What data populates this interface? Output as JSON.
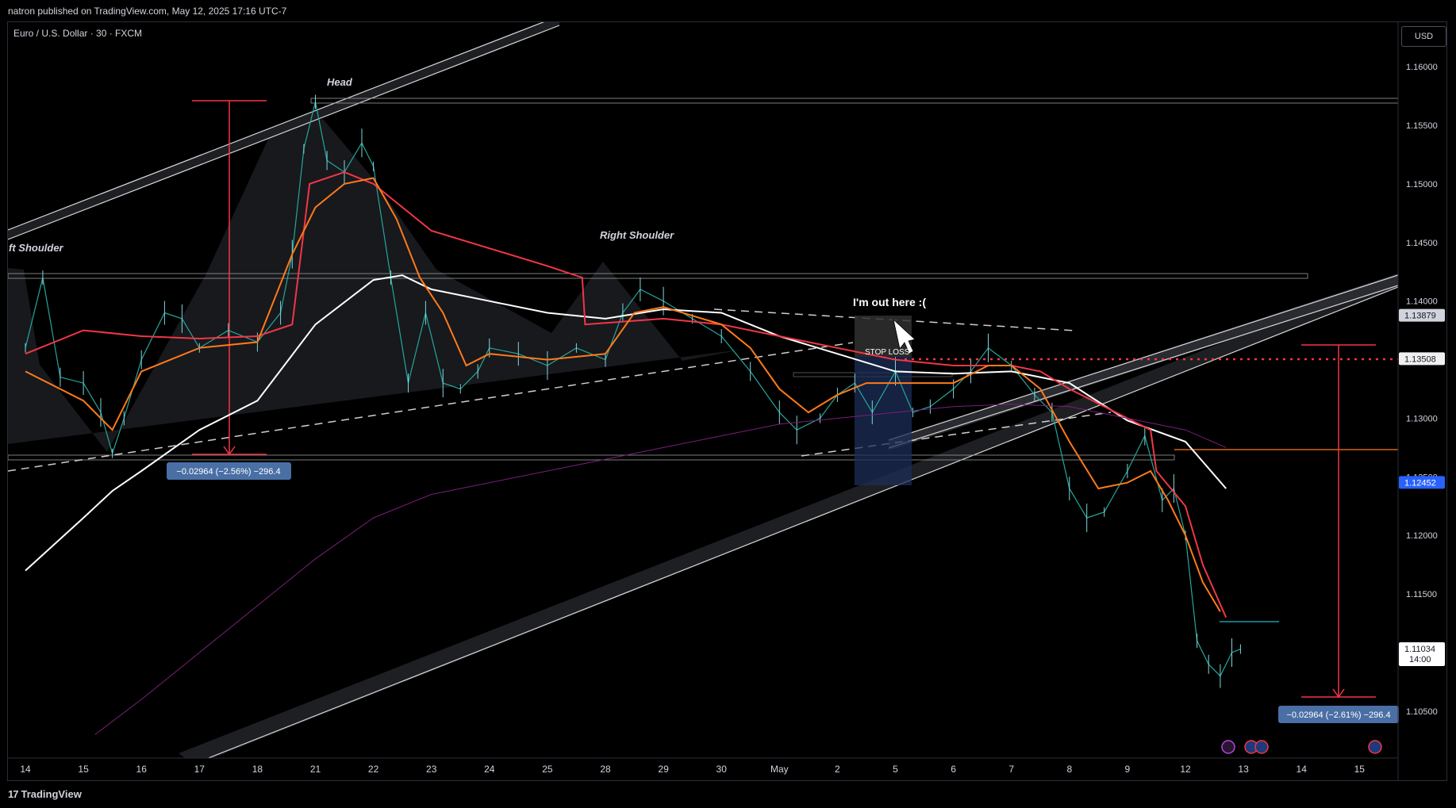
{
  "header": {
    "published_text": "natron published on TradingView.com, May 12, 2025 17:16 UTC-7"
  },
  "symbol": {
    "title": "Euro / U.S. Dollar · 30 · FXCM",
    "currency": "USD"
  },
  "footer": {
    "brand": "TradingView",
    "logo_glyph": "17"
  },
  "chart_data": {
    "type": "line",
    "title": "",
    "instrument": "Euro / U.S. Dollar",
    "interval": "30",
    "source": "FXCM",
    "y_ticks": [
      1.16,
      1.155,
      1.15,
      1.145,
      1.14,
      1.135,
      1.13,
      1.125,
      1.12,
      1.115,
      1.105
    ],
    "y_tick_labels": [
      "1.16000",
      "1.15500",
      "1.15000",
      "1.14500",
      "1.14000",
      "1.13500",
      "1.13000",
      "1.12500",
      "1.12000",
      "1.11500",
      "1.10500"
    ],
    "ylim": [
      1.101,
      1.1638
    ],
    "x_ticks": [
      "14",
      "15",
      "16",
      "17",
      "18",
      "21",
      "22",
      "23",
      "24",
      "25",
      "28",
      "29",
      "30",
      "May",
      "2",
      "5",
      "6",
      "7",
      "8",
      "9",
      "12",
      "13",
      "14",
      "15"
    ],
    "price_tags": [
      {
        "value": 1.13879,
        "label": "1.13879",
        "color": "#d1d4dc",
        "text_color": "#131722"
      },
      {
        "value": 1.13508,
        "label": "1.13508",
        "color": "#f0f0f0",
        "text_color": "#131722"
      },
      {
        "value": 1.12452,
        "label": "1.12452",
        "color": "#2962ff",
        "text_color": "#ffffff"
      },
      {
        "value": 1.11034,
        "label": "1.11034",
        "sublabel": "14:00",
        "color": "#ffffff",
        "text_color": "#131722"
      }
    ],
    "price_series": [
      [
        0,
        1.136
      ],
      [
        0.3,
        1.142
      ],
      [
        0.6,
        1.1335
      ],
      [
        1,
        1.133
      ],
      [
        1.3,
        1.1305
      ],
      [
        1.5,
        1.127
      ],
      [
        1.7,
        1.13
      ],
      [
        2,
        1.135
      ],
      [
        2.4,
        1.139
      ],
      [
        2.7,
        1.1385
      ],
      [
        3,
        1.136
      ],
      [
        3.5,
        1.1375
      ],
      [
        4,
        1.1365
      ],
      [
        4.4,
        1.139
      ],
      [
        4.6,
        1.144
      ],
      [
        4.8,
        1.153
      ],
      [
        5,
        1.157
      ],
      [
        5.2,
        1.152
      ],
      [
        5.5,
        1.151
      ],
      [
        5.8,
        1.1535
      ],
      [
        6,
        1.1515
      ],
      [
        6.3,
        1.142
      ],
      [
        6.6,
        1.133
      ],
      [
        6.9,
        1.139
      ],
      [
        7.2,
        1.133
      ],
      [
        7.5,
        1.1325
      ],
      [
        7.8,
        1.134
      ],
      [
        8,
        1.136
      ],
      [
        8.5,
        1.1355
      ],
      [
        9,
        1.1345
      ],
      [
        9.5,
        1.136
      ],
      [
        10,
        1.135
      ],
      [
        10.3,
        1.139
      ],
      [
        10.6,
        1.141
      ],
      [
        11,
        1.14
      ],
      [
        11.5,
        1.1385
      ],
      [
        12,
        1.137
      ],
      [
        12.5,
        1.134
      ],
      [
        13,
        1.1305
      ],
      [
        13.3,
        1.129
      ],
      [
        13.7,
        1.13
      ],
      [
        14,
        1.132
      ],
      [
        14.3,
        1.133
      ],
      [
        14.6,
        1.1305
      ],
      [
        15,
        1.134
      ],
      [
        15.3,
        1.1305
      ],
      [
        15.6,
        1.131
      ],
      [
        16,
        1.1325
      ],
      [
        16.3,
        1.134
      ],
      [
        16.6,
        1.136
      ],
      [
        17,
        1.1345
      ],
      [
        17.4,
        1.132
      ],
      [
        17.7,
        1.1305
      ],
      [
        18,
        1.124
      ],
      [
        18.3,
        1.1215
      ],
      [
        18.6,
        1.122
      ],
      [
        19,
        1.1255
      ],
      [
        19.3,
        1.1285
      ],
      [
        19.6,
        1.123
      ],
      [
        19.8,
        1.124
      ],
      [
        20,
        1.12
      ],
      [
        20.2,
        1.111
      ],
      [
        20.4,
        1.109
      ],
      [
        20.6,
        1.108
      ],
      [
        20.8,
        1.11
      ],
      [
        20.95,
        1.1103
      ]
    ],
    "series": [
      {
        "name": "",
        "color": "#ffffff",
        "points": [
          [
            0,
            1.117
          ],
          [
            1,
            1.1215
          ],
          [
            1.5,
            1.1238
          ],
          [
            2,
            1.1255
          ],
          [
            3,
            1.129
          ],
          [
            4,
            1.1315
          ],
          [
            5,
            1.138
          ],
          [
            6,
            1.1418
          ],
          [
            6.5,
            1.1422
          ],
          [
            7,
            1.141
          ],
          [
            8,
            1.14
          ],
          [
            9,
            1.139
          ],
          [
            10,
            1.1385
          ],
          [
            11,
            1.1393
          ],
          [
            12,
            1.139
          ],
          [
            13,
            1.137
          ],
          [
            14,
            1.1355
          ],
          [
            15,
            1.134
          ],
          [
            16,
            1.1338
          ],
          [
            17,
            1.134
          ],
          [
            18,
            1.133
          ],
          [
            19,
            1.1298
          ],
          [
            20,
            1.128
          ],
          [
            20.7,
            1.124
          ]
        ]
      },
      {
        "name": "",
        "color": "#f23645",
        "points": [
          [
            0,
            1.1355
          ],
          [
            1,
            1.1375
          ],
          [
            2,
            1.137
          ],
          [
            3,
            1.1368
          ],
          [
            4,
            1.137
          ],
          [
            4.6,
            1.138
          ],
          [
            4.9,
            1.15
          ],
          [
            5.5,
            1.151
          ],
          [
            6,
            1.15
          ],
          [
            7,
            1.146
          ],
          [
            8,
            1.1445
          ],
          [
            9,
            1.143
          ],
          [
            9.6,
            1.142
          ],
          [
            9.65,
            1.138
          ],
          [
            11,
            1.1385
          ],
          [
            12,
            1.138
          ],
          [
            13,
            1.137
          ],
          [
            14,
            1.136
          ],
          [
            15,
            1.135
          ],
          [
            16,
            1.1345
          ],
          [
            17,
            1.1345
          ],
          [
            17.5,
            1.134
          ],
          [
            18,
            1.1325
          ],
          [
            19,
            1.13
          ],
          [
            19.4,
            1.129
          ],
          [
            19.5,
            1.1255
          ],
          [
            20,
            1.1225
          ],
          [
            20.3,
            1.1175
          ],
          [
            20.7,
            1.113
          ]
        ]
      },
      {
        "name": "",
        "color": "#ff7a1a",
        "points": [
          [
            0,
            1.134
          ],
          [
            1,
            1.1315
          ],
          [
            1.5,
            1.129
          ],
          [
            2,
            1.134
          ],
          [
            3,
            1.136
          ],
          [
            4,
            1.1365
          ],
          [
            4.6,
            1.144
          ],
          [
            5,
            1.148
          ],
          [
            5.5,
            1.15
          ],
          [
            6,
            1.1505
          ],
          [
            6.4,
            1.147
          ],
          [
            6.8,
            1.142
          ],
          [
            7.2,
            1.139
          ],
          [
            7.6,
            1.1345
          ],
          [
            8,
            1.1355
          ],
          [
            9,
            1.135
          ],
          [
            10,
            1.1355
          ],
          [
            10.5,
            1.139
          ],
          [
            11,
            1.1395
          ],
          [
            12,
            1.138
          ],
          [
            12.5,
            1.136
          ],
          [
            13,
            1.1325
          ],
          [
            13.5,
            1.1305
          ],
          [
            14,
            1.132
          ],
          [
            14.5,
            1.133
          ],
          [
            15,
            1.133
          ],
          [
            16,
            1.133
          ],
          [
            16.6,
            1.1345
          ],
          [
            17,
            1.1345
          ],
          [
            17.5,
            1.1325
          ],
          [
            18,
            1.128
          ],
          [
            18.5,
            1.124
          ],
          [
            19,
            1.1245
          ],
          [
            19.4,
            1.1255
          ],
          [
            19.7,
            1.123
          ],
          [
            20,
            1.12
          ],
          [
            20.3,
            1.116
          ],
          [
            20.6,
            1.1135
          ]
        ]
      },
      {
        "name": "",
        "color": "#7b1e7a",
        "points": [
          [
            1.2,
            1.103
          ],
          [
            2,
            1.106
          ],
          [
            3,
            1.11
          ],
          [
            4,
            1.114
          ],
          [
            5,
            1.118
          ],
          [
            6,
            1.1215
          ],
          [
            7,
            1.1235
          ],
          [
            8,
            1.1245
          ],
          [
            9,
            1.1255
          ],
          [
            10,
            1.1265
          ],
          [
            11,
            1.1275
          ],
          [
            12,
            1.1285
          ],
          [
            13,
            1.1295
          ],
          [
            14,
            1.13
          ],
          [
            15,
            1.1305
          ],
          [
            16,
            1.131
          ],
          [
            17,
            1.1312
          ],
          [
            18,
            1.131
          ],
          [
            19,
            1.13
          ],
          [
            20,
            1.129
          ],
          [
            20.7,
            1.1275
          ]
        ]
      }
    ],
    "annotations": [
      {
        "text": "Head",
        "style": "italic"
      },
      {
        "text": "ft Shoulder",
        "style": "italic"
      },
      {
        "text": "Right Shoulder",
        "style": "italic"
      },
      {
        "text": "I'm out here :(",
        "style": "bold"
      },
      {
        "text": "STOP LOSS",
        "style": "normal"
      }
    ],
    "measurements": [
      {
        "label": "−0.02964 (−2.56%) −296.4"
      },
      {
        "label": "−0.02964 (−2.61%) −296.4"
      }
    ],
    "grid": false,
    "legend": "none"
  }
}
